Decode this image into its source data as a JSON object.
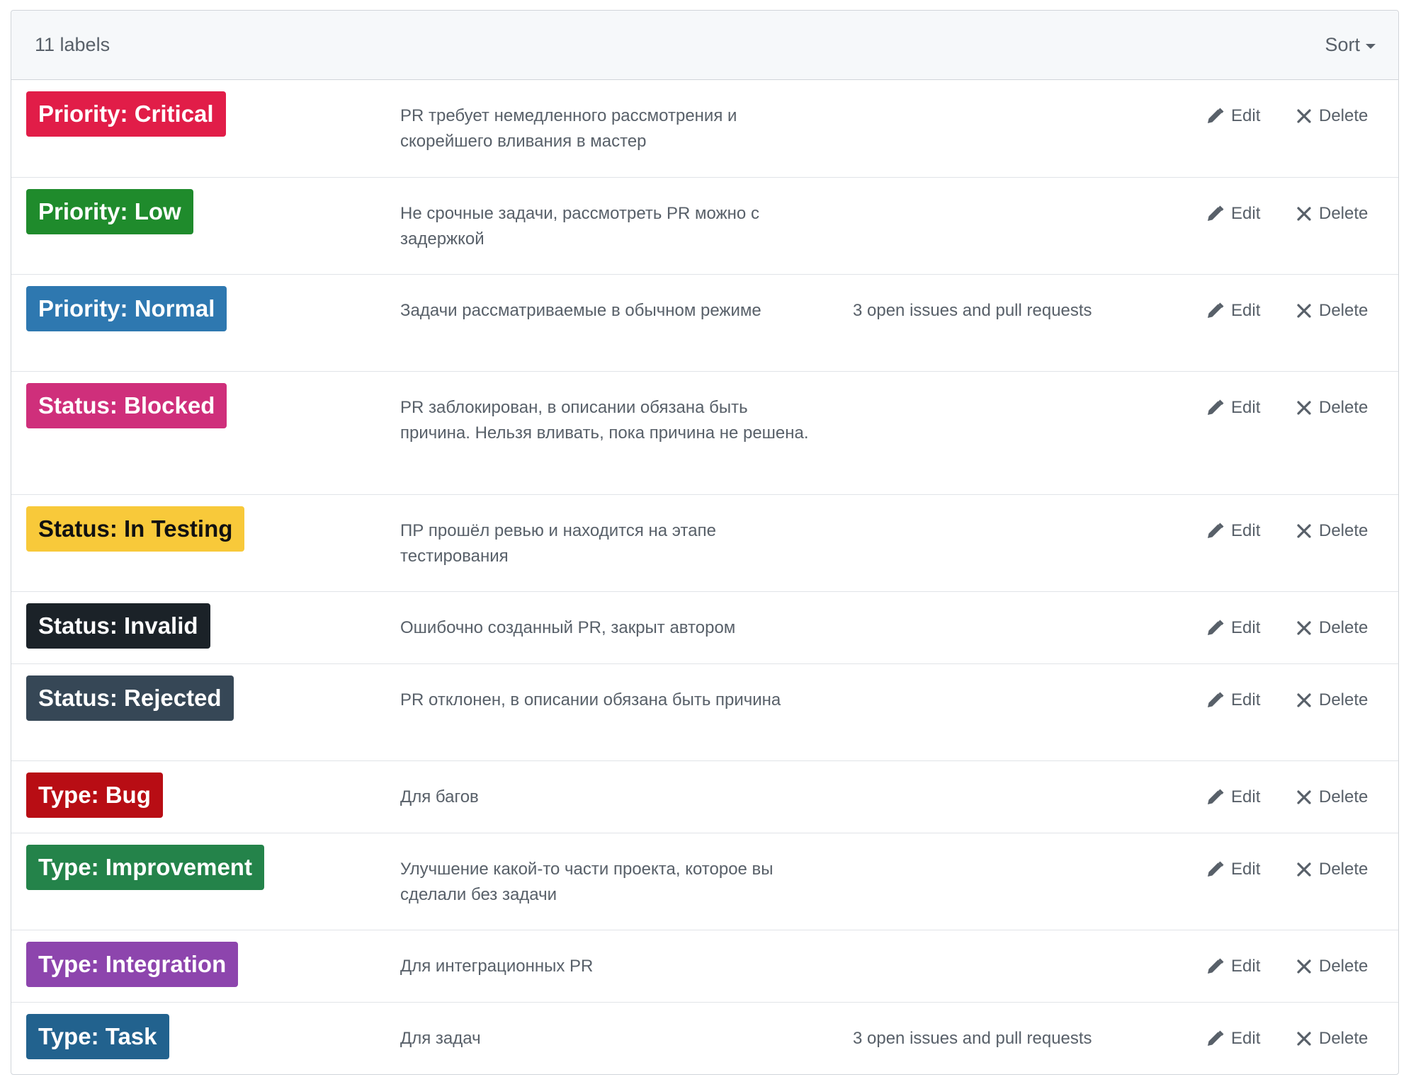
{
  "header": {
    "count_label": "11 labels",
    "sort_label": "Sort"
  },
  "actions": {
    "edit_label": "Edit",
    "delete_label": "Delete"
  },
  "labels": [
    {
      "name": "Priority: Critical",
      "color": "#e11d48",
      "text_color": "#ffffff",
      "description": "PR требует немедленного рассмотрения и скорейшего вливания в мастер",
      "issues": ""
    },
    {
      "name": "Priority: Low",
      "color": "#1f8b2c",
      "text_color": "#ffffff",
      "description": "Не срочные задачи, рассмотреть PR можно с задержкой",
      "issues": ""
    },
    {
      "name": "Priority: Normal",
      "color": "#2e78b0",
      "text_color": "#ffffff",
      "description": "Задачи рассматриваемые в обычном режиме",
      "issues": "3 open issues and pull requests"
    },
    {
      "name": "Status: Blocked",
      "color": "#cf2f7b",
      "text_color": "#ffffff",
      "description": "PR заблокирован, в описании обязана быть причина. Нельзя вливать, пока причина не решена.",
      "issues": ""
    },
    {
      "name": "Status: In Testing",
      "color": "#f8c93a",
      "text_color": "#111111",
      "description": "ПР прошёл ревью и находится на этапе тестирования",
      "issues": ""
    },
    {
      "name": "Status: Invalid",
      "color": "#1b2228",
      "text_color": "#ffffff",
      "description": "Ошибочно созданный PR, закрыт автором",
      "issues": ""
    },
    {
      "name": "Status: Rejected",
      "color": "#364756",
      "text_color": "#ffffff",
      "description": "PR отклонен, в описании обязана быть причина",
      "issues": ""
    },
    {
      "name": "Type: Bug",
      "color": "#b80d14",
      "text_color": "#ffffff",
      "description": "Для багов",
      "issues": ""
    },
    {
      "name": "Type: Improvement",
      "color": "#24834a",
      "text_color": "#ffffff",
      "description": "Улучшение какой-то части проекта, которое вы сделали без задачи",
      "issues": ""
    },
    {
      "name": "Type: Integration",
      "color": "#8d45ad",
      "text_color": "#ffffff",
      "description": "Для интеграционных PR",
      "issues": ""
    },
    {
      "name": "Type: Task",
      "color": "#22628e",
      "text_color": "#ffffff",
      "description": "Для задач",
      "issues": "3 open issues and pull requests"
    }
  ]
}
